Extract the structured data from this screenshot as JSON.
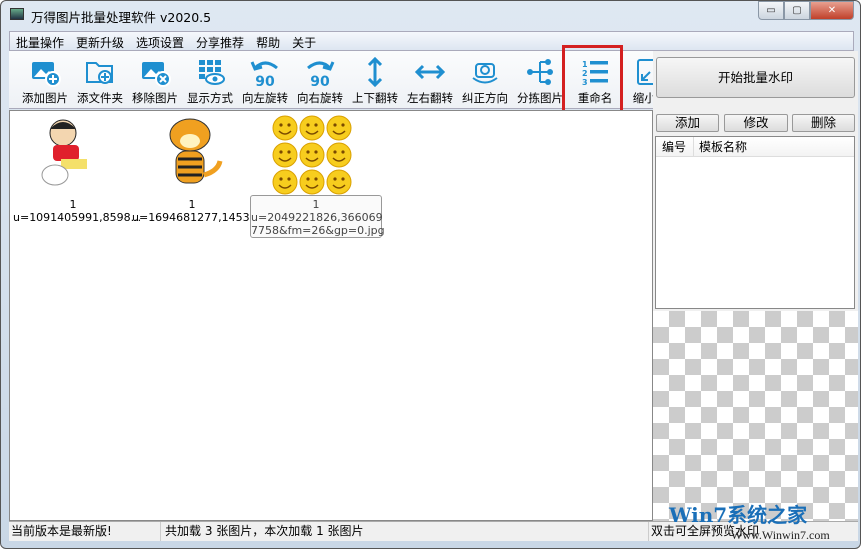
{
  "window": {
    "title": "万得图片批量处理软件 v2020.5",
    "minimize": "▭",
    "maximize": "▢",
    "close": "✕"
  },
  "menu": [
    "批量操作",
    "更新升级",
    "选项设置",
    "分享推荐",
    "帮助",
    "关于"
  ],
  "toolbar": [
    {
      "label": "添加图片",
      "icon": "add-image-icon"
    },
    {
      "label": "添文件夹",
      "icon": "add-folder-icon"
    },
    {
      "label": "移除图片",
      "icon": "remove-image-icon"
    },
    {
      "label": "显示方式",
      "icon": "display-mode-icon"
    },
    {
      "label": "向左旋转",
      "icon": "rotate-left-90-icon"
    },
    {
      "label": "向右旋转",
      "icon": "rotate-right-90-icon"
    },
    {
      "label": "上下翻转",
      "icon": "flip-vertical-icon"
    },
    {
      "label": "左右翻转",
      "icon": "flip-horizontal-icon"
    },
    {
      "label": "纠正方向",
      "icon": "correct-orientation-icon"
    },
    {
      "label": "分拣图片",
      "icon": "sort-images-icon"
    },
    {
      "label": "重命名",
      "icon": "rename-numbered-list-icon"
    },
    {
      "label": "缩小图",
      "icon": "shrink-image-icon"
    }
  ],
  "rotate_text": "90",
  "images": [
    {
      "index": "1",
      "name": "u=1091405991,8598..."
    },
    {
      "index": "1",
      "name": "u=1694681277,1453..."
    },
    {
      "index": "1",
      "name": "u=2049221826,366069"
    }
  ],
  "tooltip": {
    "index": "1",
    "line1": "u=2049221826,366069",
    "line2": "7758&fm=26&gp=0.jpg"
  },
  "right_panel": {
    "start_button": "开始批量水印",
    "add": "添加",
    "edit": "修改",
    "delete": "删除",
    "col_id": "编号",
    "col_name": "模板名称"
  },
  "status": {
    "version": "当前版本是最新版!",
    "loaded": "共加载 3 张图片，本次加载 1 张图片",
    "hint": "双击可全屏预览水印"
  },
  "watermark": {
    "logo": "Win7系统之家",
    "url": "Www.Winwin7.com"
  },
  "colors": {
    "icon_blue": "#1f8fd0",
    "highlight_red": "#d42020"
  }
}
